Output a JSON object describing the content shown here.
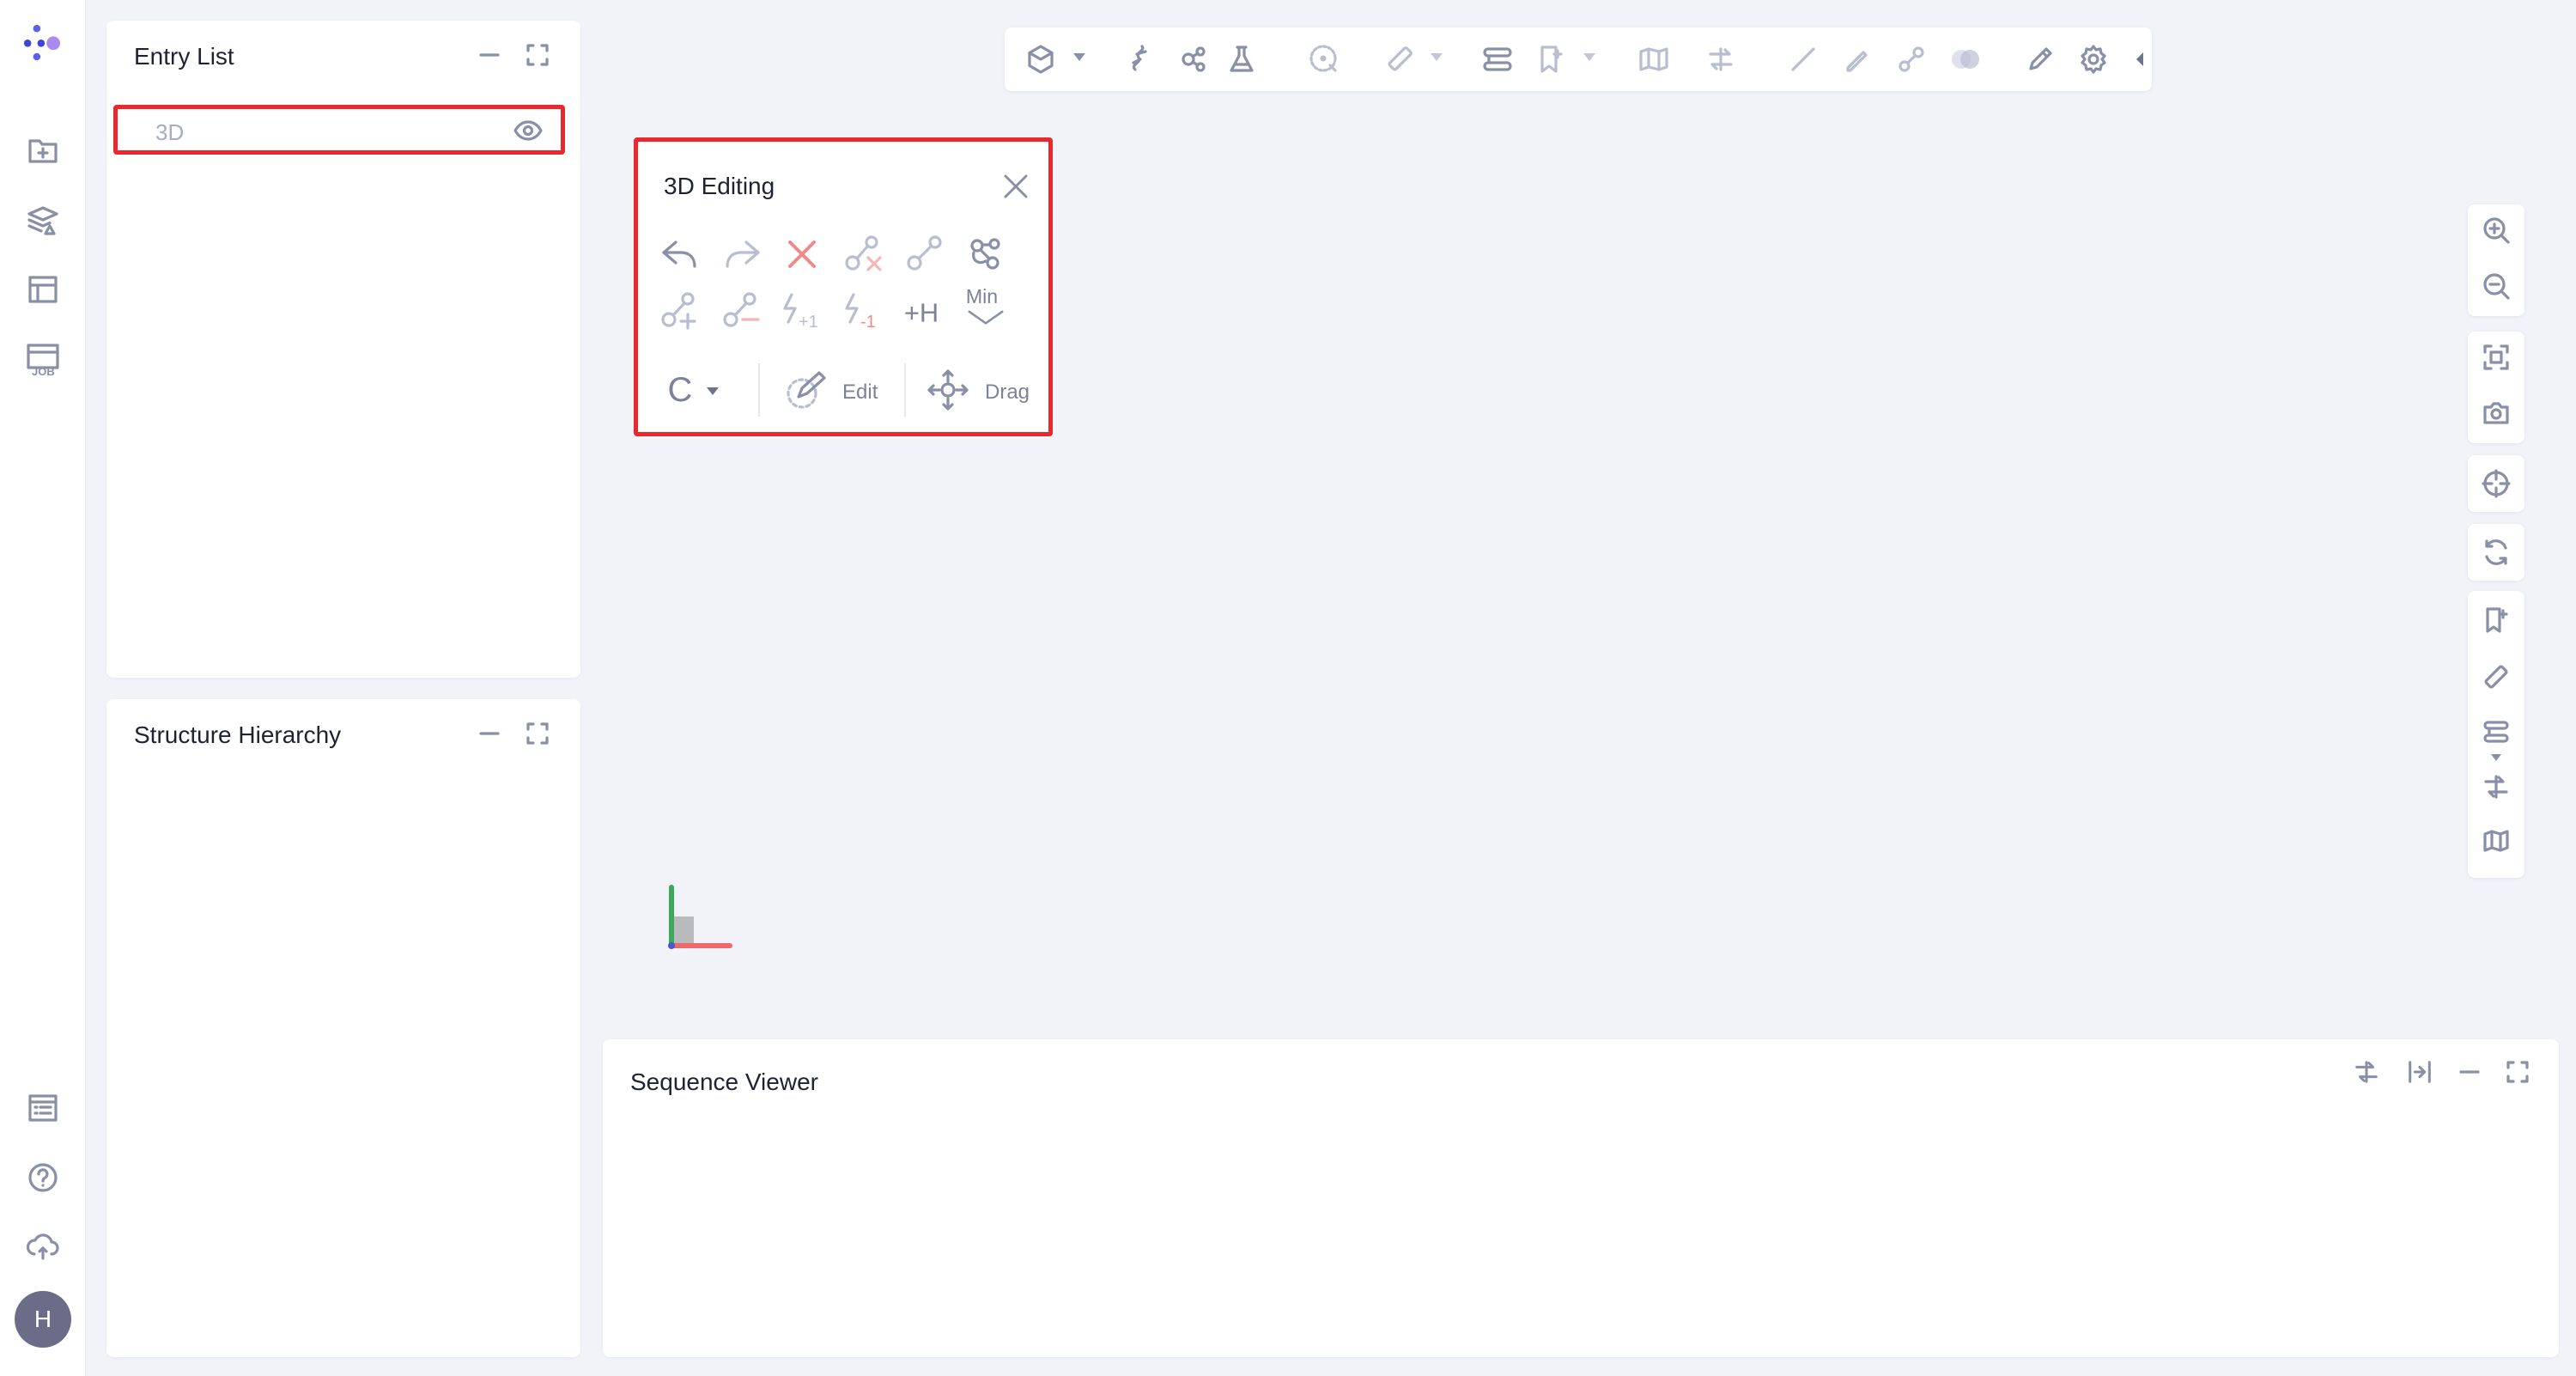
{
  "rail": {
    "logo": "app-logo",
    "items": [
      {
        "name": "new-folder-icon"
      },
      {
        "name": "layers-icon"
      },
      {
        "name": "layout-icon"
      },
      {
        "name": "job-icon",
        "label": "JOB"
      }
    ],
    "bottom": [
      {
        "name": "list-icon"
      },
      {
        "name": "help-icon"
      },
      {
        "name": "cloud-sync-icon"
      }
    ],
    "avatar_initial": "H"
  },
  "entry_list": {
    "title": "Entry List",
    "items": [
      {
        "label": "3D",
        "visible": true
      }
    ]
  },
  "structure_hierarchy": {
    "title": "Structure Hierarchy"
  },
  "editing": {
    "title": "3D Editing",
    "element_label": "C",
    "edit_label": "Edit",
    "drag_label": "Drag",
    "plus_h_label": "+H",
    "min_label": "Min",
    "charge_plus": "+1",
    "charge_minus": "-1"
  },
  "sequence_viewer": {
    "title": "Sequence Viewer"
  },
  "colors": {
    "highlight": "#e8282c",
    "avatar": "#6b6d88",
    "logo_blue": "#3c45d8",
    "logo_purple": "#a98af0"
  }
}
